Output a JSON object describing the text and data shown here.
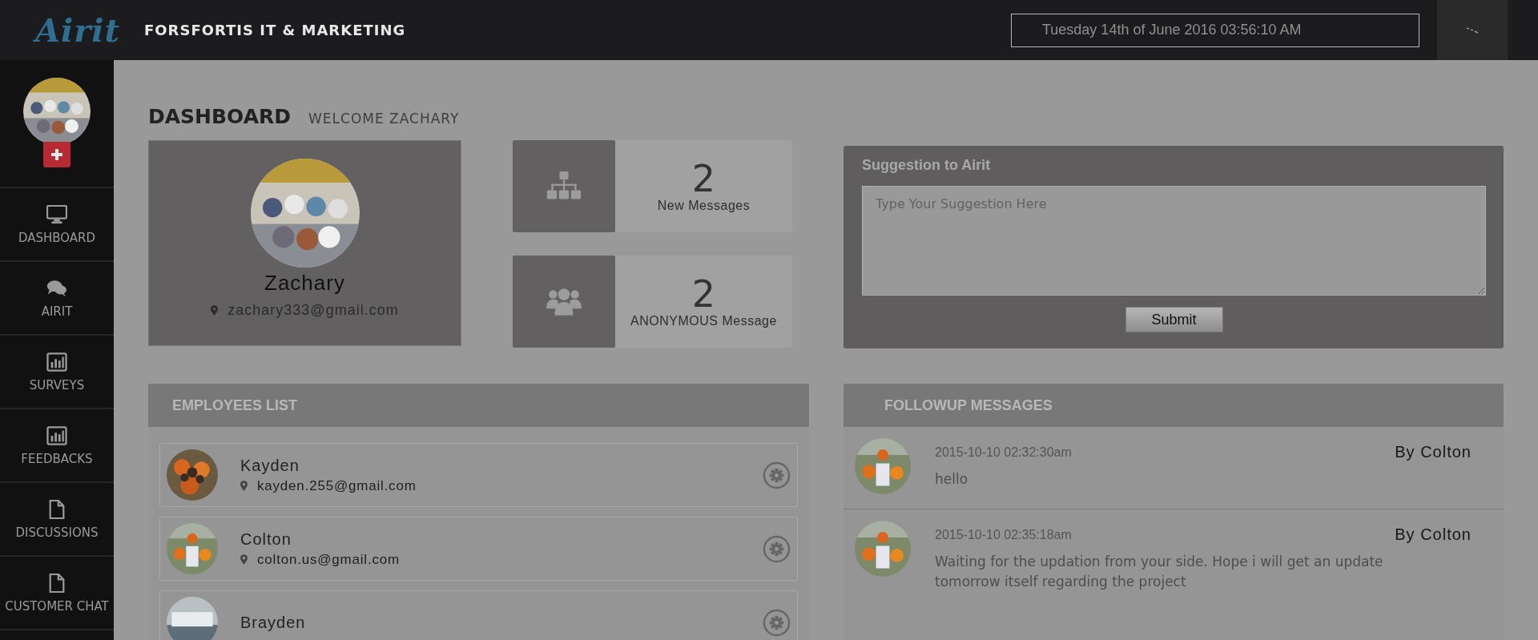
{
  "header": {
    "logo": "Airit",
    "company": "FORSFORTIS IT & MARKETING",
    "datetime": "Tuesday 14th of June 2016 03:56:10 AM"
  },
  "sidebar": {
    "items": [
      {
        "label": "DASHBOARD",
        "kind": "monitor"
      },
      {
        "label": "AIRIT",
        "kind": "chat"
      },
      {
        "label": "SURVEYS",
        "kind": "chart"
      },
      {
        "label": "FEEDBACKS",
        "kind": "chart"
      },
      {
        "label": "DISCUSSIONS",
        "kind": "file"
      },
      {
        "label": "CUSTOMER CHAT",
        "kind": "file"
      }
    ]
  },
  "page": {
    "title": "DASHBOARD",
    "welcome": "WELCOME ZACHARY"
  },
  "profile": {
    "name": "Zachary",
    "email": "zachary333@gmail.com"
  },
  "stats": [
    {
      "value": "2",
      "label": "New Messages",
      "kind": "sitemap"
    },
    {
      "value": "2",
      "label": "ANONYMOUS Message",
      "kind": "users"
    }
  ],
  "suggestion": {
    "title": "Suggestion to Airit",
    "placeholder": "Type Your Suggestion Here",
    "button": "Submit"
  },
  "employees": {
    "title": "EMPLOYEES LIST",
    "items": [
      {
        "name": "Kayden",
        "email": "kayden.255@gmail.com"
      },
      {
        "name": "Colton",
        "email": "colton.us@gmail.com"
      },
      {
        "name": "Brayden"
      }
    ]
  },
  "followups": {
    "title": "FOLLOWUP MESSAGES",
    "items": [
      {
        "time": "2015-10-10 02:32:30am",
        "author": "By Colton",
        "text": "hello"
      },
      {
        "time": "2015-10-10 02:35:18am",
        "author": "By Colton",
        "text": "Waiting for the updation from your side. Hope i will get an update tomorrow itself regarding the project"
      }
    ]
  }
}
